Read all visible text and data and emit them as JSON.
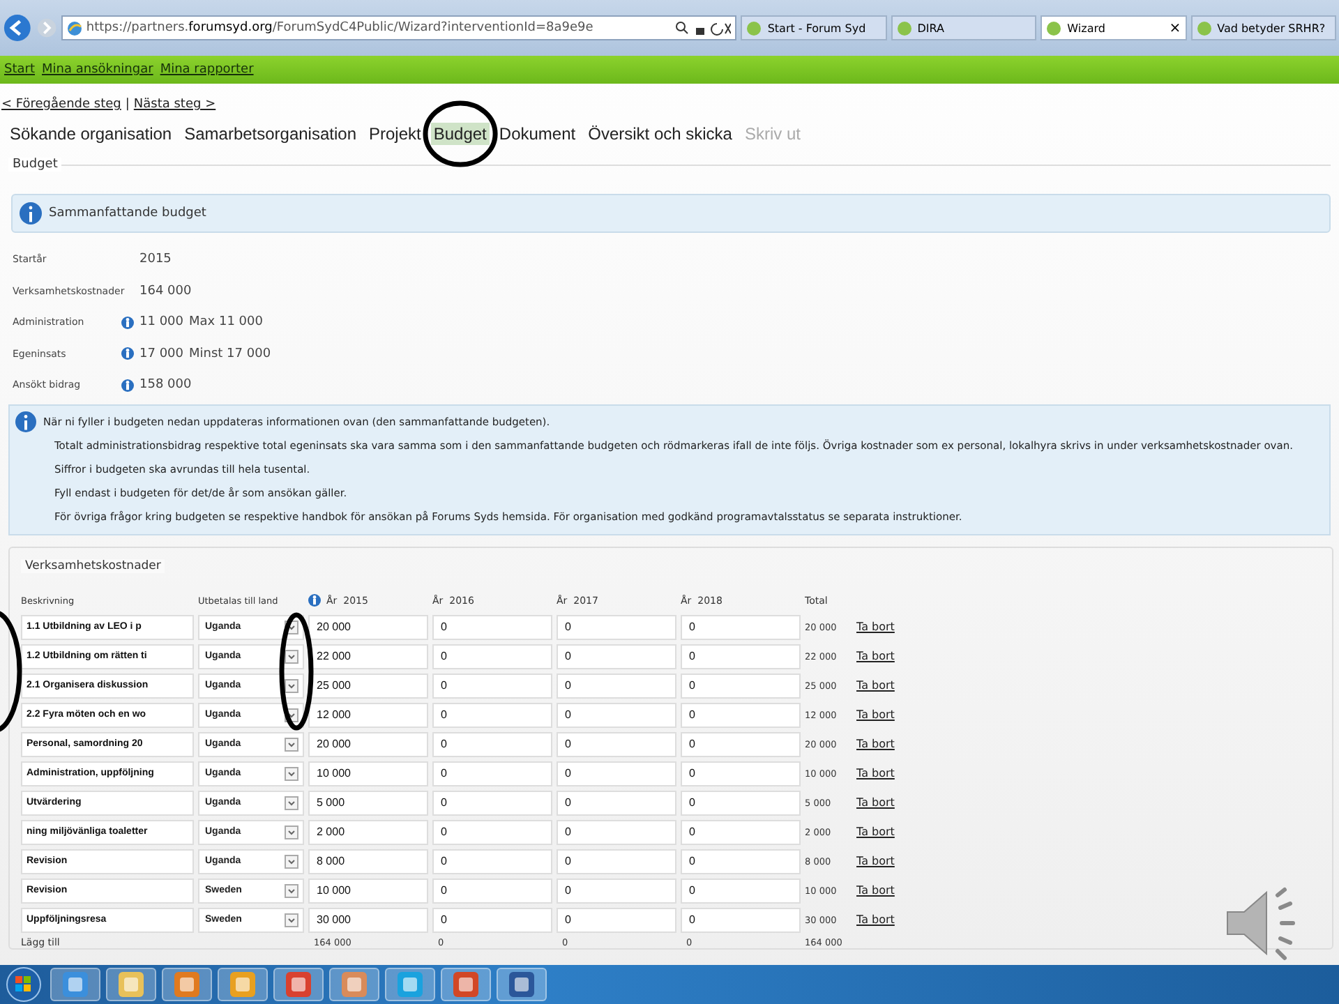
{
  "browser": {
    "address": "https://partners.**forumsyd.org**/ForumSydC4Public/Wizard?interventionId=8a9e9e",
    "tabs": [
      {
        "title": "Start - Forum Syd",
        "selected": false
      },
      {
        "title": "DIRA",
        "selected": false
      },
      {
        "title": "Wizard",
        "selected": true,
        "close": "×"
      },
      {
        "title": "Vad betyder SRHR?",
        "selected": false
      }
    ]
  },
  "top_nav": [
    "Start",
    "Mina ansökningar",
    "Mina rapporter"
  ],
  "step_nav": {
    "previous": "< Föregående steg",
    "separator": "|",
    "next": "Nästa steg >"
  },
  "wizard_tabs": [
    {
      "label": "Sökande organisation",
      "selected": false,
      "disabled": false
    },
    {
      "label": "Samarbetsorganisation",
      "selected": false,
      "disabled": false
    },
    {
      "label": "Projekt",
      "selected": false,
      "disabled": false
    },
    {
      "label": "Budget",
      "selected": true,
      "disabled": false
    },
    {
      "label": "Dokument",
      "selected": false,
      "disabled": false
    },
    {
      "label": "Översikt och skicka",
      "selected": false,
      "disabled": false
    },
    {
      "label": "Skriv ut",
      "selected": false,
      "disabled": true
    }
  ],
  "section_title": "Budget",
  "summary_banner": "Sammanfattande budget",
  "summary_rows": [
    {
      "label": "Startår",
      "value": "2015",
      "info": false
    },
    {
      "label": "Verksamhetskostnader",
      "value": "164 000",
      "info": false
    },
    {
      "label": "Administration",
      "value": "11 000",
      "limit": "Max 11 000",
      "info": true
    },
    {
      "label": "Egeninsats",
      "value": "17 000",
      "limit": "Minst 17 000",
      "info": true
    },
    {
      "label": "Ansökt bidrag",
      "value": "158 000",
      "info": true
    }
  ],
  "notes": [
    "När ni fyller i budgeten nedan uppdateras informationen ovan (den sammanfattande budgeten).",
    "Totalt administrationsbidrag respektive total egeninsats ska vara samma som i den sammanfattande budgeten och rödmarkeras ifall de inte följs. Övriga kostnader som ex personal, lokalhyra skrivs in under verksamhetskostnader ovan.",
    "Siffror i budgeten ska avrundas till hela tusental.",
    "Fyll endast i budgeten för det/de år som ansökan gäller.",
    "För övriga frågor kring budgeten se respektive handbok för ansökan på Forums Syds hemsida. För organisation med godkänd programavtalsstatus se separata instruktioner."
  ],
  "costs": {
    "title": "Verksamhetskostnader",
    "columns": [
      {
        "label": "Beskrivning",
        "info": false
      },
      {
        "label": "Utbetalas till land",
        "info": false
      },
      {
        "label": "År  2015",
        "info": true
      },
      {
        "label": "År  2016",
        "info": false
      },
      {
        "label": "År  2017",
        "info": false
      },
      {
        "label": "År  2018",
        "info": false
      },
      {
        "label": "Total",
        "info": false
      }
    ],
    "rows": [
      {
        "description": "1.1 Utbildning av LEO i p",
        "country": "Uganda",
        "values": [
          "20 000",
          "0",
          "0",
          "0"
        ],
        "total": "20 000",
        "action": "Ta bort"
      },
      {
        "description": "1.2 Utbildning om rätten ti",
        "country": "Uganda",
        "values": [
          "22 000",
          "0",
          "0",
          "0"
        ],
        "total": "22 000",
        "action": "Ta bort"
      },
      {
        "description": "2.1 Organisera diskussion",
        "country": "Uganda",
        "values": [
          "25 000",
          "0",
          "0",
          "0"
        ],
        "total": "25 000",
        "action": "Ta bort"
      },
      {
        "description": "2.2 Fyra möten och en wo",
        "country": "Uganda",
        "values": [
          "12 000",
          "0",
          "0",
          "0"
        ],
        "total": "12 000",
        "action": "Ta bort"
      },
      {
        "description": "Personal, samordning 20",
        "country": "Uganda",
        "values": [
          "20 000",
          "0",
          "0",
          "0"
        ],
        "total": "20 000",
        "action": "Ta bort"
      },
      {
        "description": "Administration, uppföljning",
        "country": "Uganda",
        "values": [
          "10 000",
          "0",
          "0",
          "0"
        ],
        "total": "10 000",
        "action": "Ta bort"
      },
      {
        "description": "Utvärdering",
        "country": "Uganda",
        "values": [
          "5 000",
          "0",
          "0",
          "0"
        ],
        "total": "5 000",
        "action": "Ta bort"
      },
      {
        "description": "ning miljövänliga toaletter",
        "country": "Uganda",
        "values": [
          "2 000",
          "0",
          "0",
          "0"
        ],
        "total": "2 000",
        "action": "Ta bort"
      },
      {
        "description": "Revision",
        "country": "Uganda",
        "values": [
          "8 000",
          "0",
          "0",
          "0"
        ],
        "total": "8 000",
        "action": "Ta bort"
      },
      {
        "description": "Revision",
        "country": "Sweden",
        "values": [
          "10 000",
          "0",
          "0",
          "0"
        ],
        "total": "10 000",
        "action": "Ta bort"
      },
      {
        "description": "Uppföljningsresa",
        "country": "Sweden",
        "values": [
          "30 000",
          "0",
          "0",
          "0"
        ],
        "total": "30 000",
        "action": "Ta bort"
      }
    ],
    "footer": {
      "add": "Lägg till",
      "totals": [
        "164 000",
        "0",
        "0",
        "0",
        "164 000"
      ]
    }
  },
  "annotations": [
    {
      "kind": "ellipse"
    },
    {
      "kind": "ellipse"
    },
    {
      "kind": "ellipse"
    }
  ]
}
